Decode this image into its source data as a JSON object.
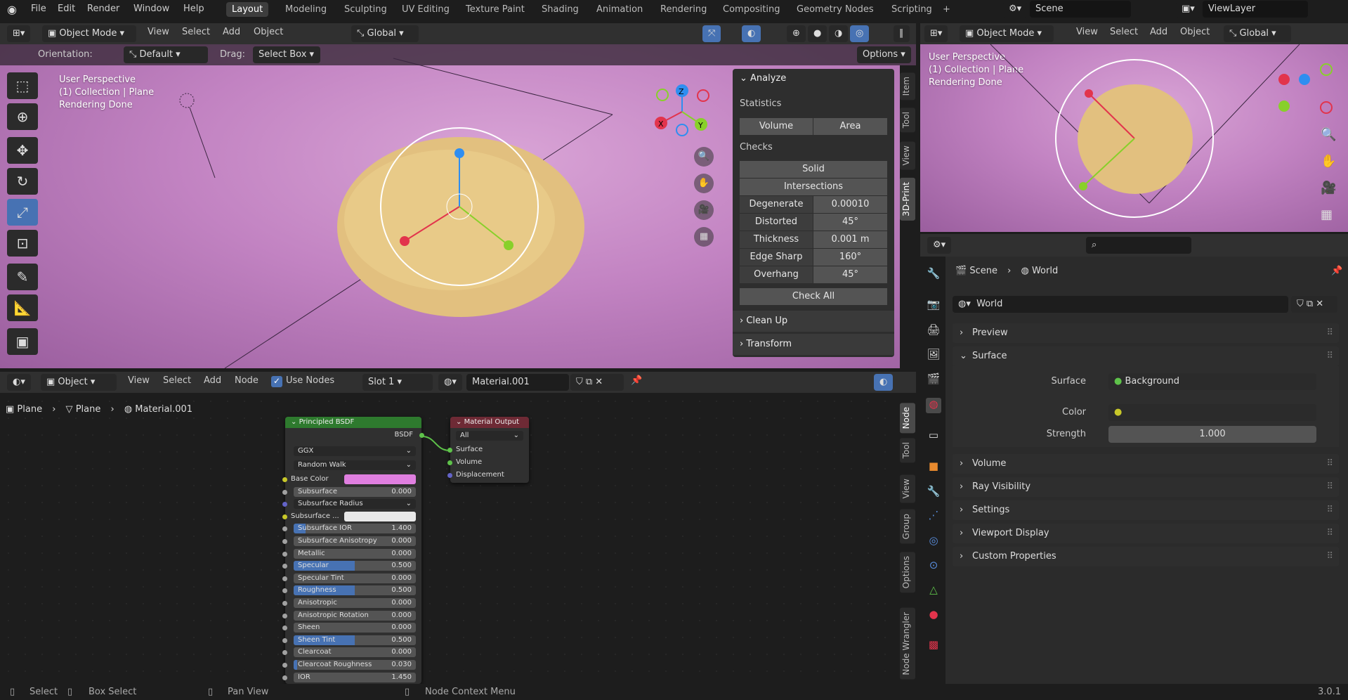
{
  "menu": {
    "items": [
      "File",
      "Edit",
      "Render",
      "Window",
      "Help"
    ]
  },
  "workspaces": {
    "tabs": [
      "Layout",
      "Modeling",
      "Sculpting",
      "UV Editing",
      "Texture Paint",
      "Shading",
      "Animation",
      "Rendering",
      "Compositing",
      "Geometry Nodes",
      "Scripting"
    ],
    "active": "Layout",
    "add": "+"
  },
  "scene": {
    "name": "Scene",
    "view_layer": "ViewLayer"
  },
  "viewport": {
    "mode": "Object Mode",
    "menus": [
      "View",
      "Select",
      "Add",
      "Object"
    ],
    "transform_orientation": "Global",
    "orientation_label": "Orientation:",
    "orientation_value": "Default",
    "drag_label": "Drag:",
    "drag_value": "Select Box",
    "options": "Options",
    "overlay": [
      "User Perspective",
      "(1) Collection | Plane",
      "Rendering Done"
    ],
    "axes": {
      "x": "X",
      "y": "Y",
      "z": "Z"
    },
    "colors": {
      "x": "#e2344c",
      "y": "#88d02a",
      "z": "#2f8ef0",
      "object": "#e2c07f",
      "background": "#c283c2"
    }
  },
  "npanel": {
    "title": "Analyze",
    "statistics": "Statistics",
    "stat_buttons": [
      "Volume",
      "Area"
    ],
    "checks": "Checks",
    "check_buttons": [
      "Solid",
      "Intersections"
    ],
    "check_rows": [
      {
        "label": "Degenerate",
        "value": "0.00010"
      },
      {
        "label": "Distorted",
        "value": "45°"
      },
      {
        "label": "Thickness",
        "value": "0.001 m"
      },
      {
        "label": "Edge Sharp",
        "value": "160°"
      },
      {
        "label": "Overhang",
        "value": "45°"
      }
    ],
    "check_all": "Check All",
    "sections": [
      "Clean Up",
      "Transform"
    ],
    "tabs": [
      "Item",
      "Tool",
      "View",
      "3D-Print"
    ]
  },
  "right_viewport": {
    "mode": "Object Mode",
    "menus": [
      "View",
      "Select",
      "Add",
      "Object"
    ],
    "transform_orientation": "Global",
    "overlay": [
      "User Perspective",
      "(1) Collection | Plane",
      "Rendering Done"
    ]
  },
  "node_editor": {
    "type": "Object",
    "menus": [
      "View",
      "Select",
      "Add",
      "Node"
    ],
    "use_nodes": "Use Nodes",
    "slot": "Slot 1",
    "material": "Material.001",
    "breadcrumb": [
      "Plane",
      "Plane",
      "Material.001"
    ],
    "tabs": [
      "Node",
      "Tool",
      "View",
      "Group",
      "Options",
      "Node Wrangler"
    ],
    "bsdf": {
      "title": "Principled BSDF",
      "output": "BSDF",
      "distribution": "GGX",
      "subsurface_method": "Random Walk",
      "inputs": [
        {
          "label": "Base Color",
          "type": "color",
          "color": "#e07fe0",
          "socket": "#c7c729"
        },
        {
          "label": "Subsurface",
          "value": "0.000",
          "fill": 0
        },
        {
          "label": "Subsurface Radius",
          "type": "dropdown",
          "socket": "#6363c7"
        },
        {
          "label": "Subsurface ...",
          "type": "color",
          "color": "#e8e8e8",
          "socket": "#c7c729"
        },
        {
          "label": "Subsurface IOR",
          "value": "1.400",
          "fill": 0.1
        },
        {
          "label": "Subsurface Anisotropy",
          "value": "0.000",
          "fill": 0
        },
        {
          "label": "Metallic",
          "value": "0.000",
          "fill": 0
        },
        {
          "label": "Specular",
          "value": "0.500",
          "fill": 0.5
        },
        {
          "label": "Specular Tint",
          "value": "0.000",
          "fill": 0
        },
        {
          "label": "Roughness",
          "value": "0.500",
          "fill": 0.5
        },
        {
          "label": "Anisotropic",
          "value": "0.000",
          "fill": 0
        },
        {
          "label": "Anisotropic Rotation",
          "value": "0.000",
          "fill": 0
        },
        {
          "label": "Sheen",
          "value": "0.000",
          "fill": 0
        },
        {
          "label": "Sheen Tint",
          "value": "0.500",
          "fill": 0.5
        },
        {
          "label": "Clearcoat",
          "value": "0.000",
          "fill": 0
        },
        {
          "label": "Clearcoat Roughness",
          "value": "0.030",
          "fill": 0.03
        },
        {
          "label": "IOR",
          "value": "1.450",
          "fill": 0
        }
      ]
    },
    "output": {
      "title": "Material Output",
      "target": "All",
      "inputs": [
        "Surface",
        "Volume",
        "Displacement"
      ]
    }
  },
  "properties": {
    "breadcrumb": [
      "Scene",
      "World"
    ],
    "world": "World",
    "panels": [
      "Preview",
      "Surface",
      "Volume",
      "Ray Visibility",
      "Settings",
      "Viewport Display",
      "Custom Properties"
    ],
    "surface_label": "Surface",
    "surface_value": "Background",
    "color_label": "Color",
    "strength_label": "Strength",
    "strength_value": "1.000"
  },
  "status": {
    "select": "Select",
    "box_select": "Box Select",
    "pan_view": "Pan View",
    "context_menu": "Node Context Menu",
    "version": "3.0.1"
  }
}
